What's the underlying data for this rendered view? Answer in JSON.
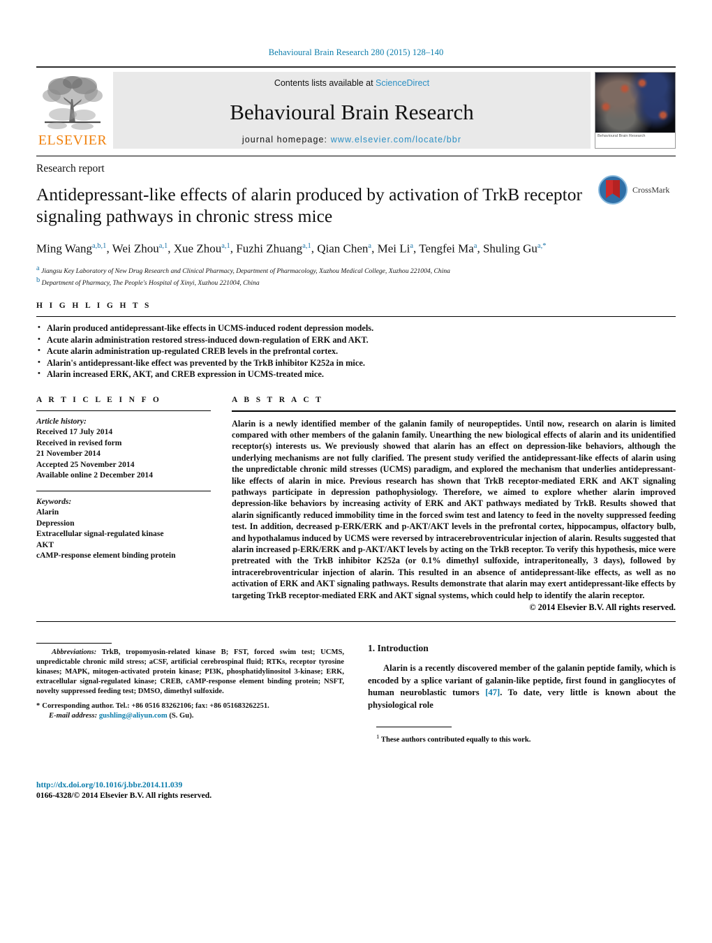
{
  "running_head": "Behavioural Brain Research 280 (2015) 128–140",
  "banner": {
    "contents_prefix": "Contents lists available at ",
    "sciencedirect": "ScienceDirect",
    "journal_title": "Behavioural Brain Research",
    "homepage_prefix": "journal homepage: ",
    "homepage_url": "www.elsevier.com/locate/bbr",
    "publisher": "ELSEVIER",
    "cover_caption": "Behavioural Brain Research"
  },
  "article": {
    "kicker": "Research report",
    "title": "Antidepressant-like effects of alarin produced by activation of TrkB receptor signaling pathways in chronic stress mice",
    "authors_html": "Ming Wang<sup>a,b,1</sup>, Wei Zhou<sup>a,1</sup>, Xue Zhou<sup>a,1</sup>, Fuzhi Zhuang<sup>a,1</sup>, Qian Chen<sup>a</sup>, Mei Li<sup>a</sup>, Tengfei Ma<sup>a</sup>, Shuling Gu<sup>a,*</sup>",
    "affiliation_a": "Jiangsu Key Laboratory of New Drug Research and Clinical Pharmacy, Department of Pharmacology, Xuzhou Medical College, Xuzhou 221004, China",
    "affiliation_b": "Department of Pharmacy, The People's Hospital of Xinyi, Xuzhou 221004, China",
    "crossmark_label": "CrossMark"
  },
  "highlights": {
    "label": "H I G H L I G H T S",
    "items": [
      "Alarin produced antidepressant-like effects in UCMS-induced rodent depression models.",
      "Acute alarin administration restored stress-induced down-regulation of ERK and AKT.",
      "Acute alarin administration up-regulated CREB levels in the prefrontal cortex.",
      "Alarin's antidepressant-like effect was prevented by the TrkB inhibitor K252a in mice.",
      "Alarin increased ERK, AKT, and CREB expression in UCMS-treated mice."
    ]
  },
  "article_info": {
    "label": "A R T I C L E    I N F O",
    "history_label": "Article history:",
    "history": [
      "Received 17 July 2014",
      "Received in revised form",
      "21 November 2014",
      "Accepted 25 November 2014",
      "Available online 2 December 2014"
    ],
    "keywords_label": "Keywords:",
    "keywords": [
      "Alarin",
      "Depression",
      "Extracellular signal-regulated kinase",
      "AKT",
      "cAMP-response element binding protein"
    ]
  },
  "abstract": {
    "label": "A B S T R A C T",
    "text": "Alarin is a newly identified member of the galanin family of neuropeptides. Until now, research on alarin is limited compared with other members of the galanin family. Unearthing the new biological effects of alarin and its unidentified receptor(s) interests us. We previously showed that alarin has an effect on depression-like behaviors, although the underlying mechanisms are not fully clarified. The present study verified the antidepressant-like effects of alarin using the unpredictable chronic mild stresses (UCMS) paradigm, and explored the mechanism that underlies antidepressant-like effects of alarin in mice. Previous research has shown that TrkB receptor-mediated ERK and AKT signaling pathways participate in depression pathophysiology. Therefore, we aimed to explore whether alarin improved depression-like behaviors by increasing activity of ERK and AKT pathways mediated by TrkB. Results showed that alarin significantly reduced immobility time in the forced swim test and latency to feed in the novelty suppressed feeding test. In addition, decreased p-ERK/ERK and p-AKT/AKT levels in the prefrontal cortex, hippocampus, olfactory bulb, and hypothalamus induced by UCMS were reversed by intracerebroventricular injection of alarin. Results suggested that alarin increased p-ERK/ERK and p-AKT/AKT levels by acting on the TrkB receptor. To verify this hypothesis, mice were pretreated with the TrkB inhibitor K252a (or 0.1% dimethyl sulfoxide, intraperitoneally, 3 days), followed by intracerebroventricular injection of alarin. This resulted in an absence of antidepressant-like effects, as well as no activation of ERK and AKT signaling pathways. Results demonstrate that alarin may exert antidepressant-like effects by targeting TrkB receptor-mediated ERK and AKT signal systems, which could help to identify the alarin receptor.",
    "copyright": "© 2014 Elsevier B.V. All rights reserved."
  },
  "footnotes": {
    "abbreviations_label": "Abbreviations:",
    "abbreviations_text": "TrkB, tropomyosin-related kinase B; FST, forced swim test; UCMS, unpredictable chronic mild stress; aCSF, artificial cerebrospinal fluid; RTKs, receptor tyrosine kinases; MAPK, mitogen-activated protein kinase; PI3K, phosphatidylinositol 3-kinase; ERK, extracellular signal-regulated kinase; CREB, cAMP-response element binding protein; NSFT, novelty suppressed feeding test; DMSO, dimethyl sulfoxide.",
    "corresponding": "Corresponding author. Tel.: +86 0516 83262106; fax: +86 051683262251.",
    "email_label": "E-mail address:",
    "email": "gushling@aliyun.com",
    "email_suffix": "(S. Gu).",
    "equal_contrib": "These authors contributed equally to this work."
  },
  "doi": {
    "url": "http://dx.doi.org/10.1016/j.bbr.2014.11.039",
    "issn_line": "0166-4328/© 2014 Elsevier B.V. All rights reserved."
  },
  "introduction": {
    "heading": "1.  Introduction",
    "paragraph_1": "Alarin is a recently discovered member of the galanin peptide family, which is encoded by a splice variant of galanin-like peptide, first found in gangliocytes of human neuroblastic tumors",
    "ref_1": "[47]",
    "paragraph_1_cont": ". To date, very little is known about the physiological role"
  },
  "colors": {
    "link": "#0b7cab",
    "elsevier_orange": "#f0820f",
    "sciencedirect": "#2b8fc4"
  }
}
